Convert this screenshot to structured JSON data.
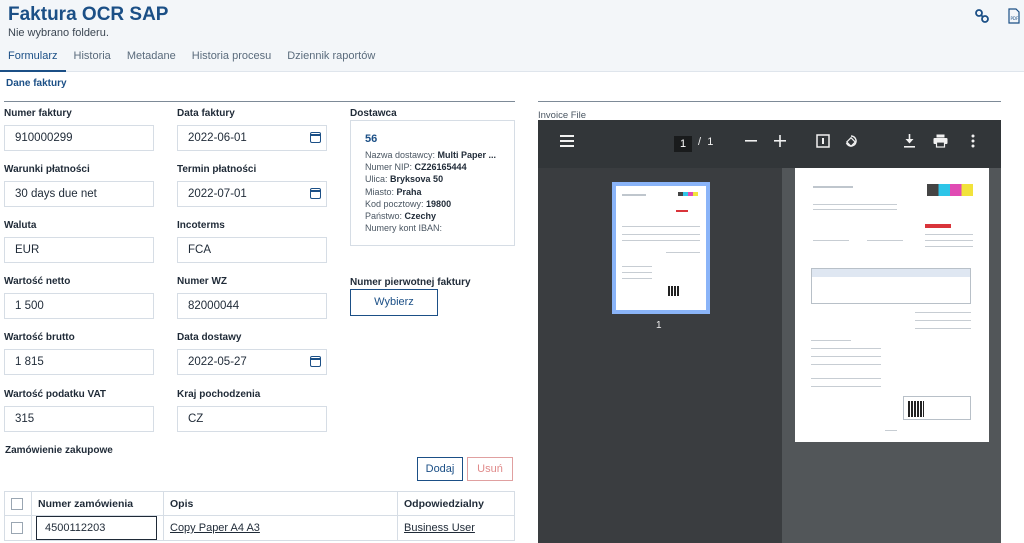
{
  "app": {
    "title": "Faktura OCR SAP",
    "subtitle": "Nie wybrano folderu."
  },
  "tabs": [
    "Formularz",
    "Historia",
    "Metadane",
    "Historia procesu",
    "Dziennik raportów"
  ],
  "section_title": "Dane faktury",
  "fields": {
    "invoice_number": {
      "label": "Numer faktury",
      "value": "910000299"
    },
    "invoice_date": {
      "label": "Data faktury",
      "value": "2022-06-01"
    },
    "payment_terms": {
      "label": "Warunki płatności",
      "value": "30 days due net"
    },
    "due_date": {
      "label": "Termin płatności",
      "value": "2022-07-01"
    },
    "currency": {
      "label": "Waluta",
      "value": "EUR"
    },
    "incoterms": {
      "label": "Incoterms",
      "value": "FCA"
    },
    "net_value": {
      "label": "Wartość netto",
      "value": "1 500"
    },
    "wz_number": {
      "label": "Numer WZ",
      "value": "82000044"
    },
    "gross_value": {
      "label": "Wartość brutto",
      "value": "1 815"
    },
    "delivery_date": {
      "label": "Data dostawy",
      "value": "2022-05-27"
    },
    "vat_value": {
      "label": "Wartość podatku VAT",
      "value": "315"
    },
    "origin_country": {
      "label": "Kraj pochodzenia",
      "value": "CZ"
    }
  },
  "supplier": {
    "label": "Dostawca",
    "id": "56",
    "name_label": "Nazwa dostawcy:",
    "name": "Multi Paper ...",
    "nip_label": "Numer NIP:",
    "nip": "CZ26165444",
    "street_label": "Ulica:",
    "street": "Bryksova 50",
    "city_label": "Miasto:",
    "city": "Praha",
    "zip_label": "Kod pocztowy:",
    "zip": "19800",
    "country_label": "Państwo:",
    "country": "Czechy",
    "iban_label": "Numery kont IBAN:"
  },
  "original_invoice": {
    "label": "Numer pierwotnej faktury",
    "button": "Wybierz"
  },
  "purchase_order": {
    "title": "Zamówienie zakupowe",
    "add_button": "Dodaj",
    "remove_button": "Usuń",
    "columns": [
      "Numer zamówienia",
      "Opis",
      "Odpowiedzialny"
    ],
    "rows": [
      {
        "number": "4500112203",
        "description": "Copy Paper A4 A3",
        "responsible": "Business User"
      }
    ]
  },
  "viewer": {
    "label": "Invoice File",
    "page_current": "1",
    "page_separator": "/",
    "page_total": "1",
    "thumb_number": "1"
  },
  "colors": {
    "brand": "#1b4f86",
    "viewer_toolbar": "#323639",
    "viewer_background": "#525659",
    "thumb_border": "#8ab4f8",
    "danger_disabled": "#e08a8a"
  }
}
